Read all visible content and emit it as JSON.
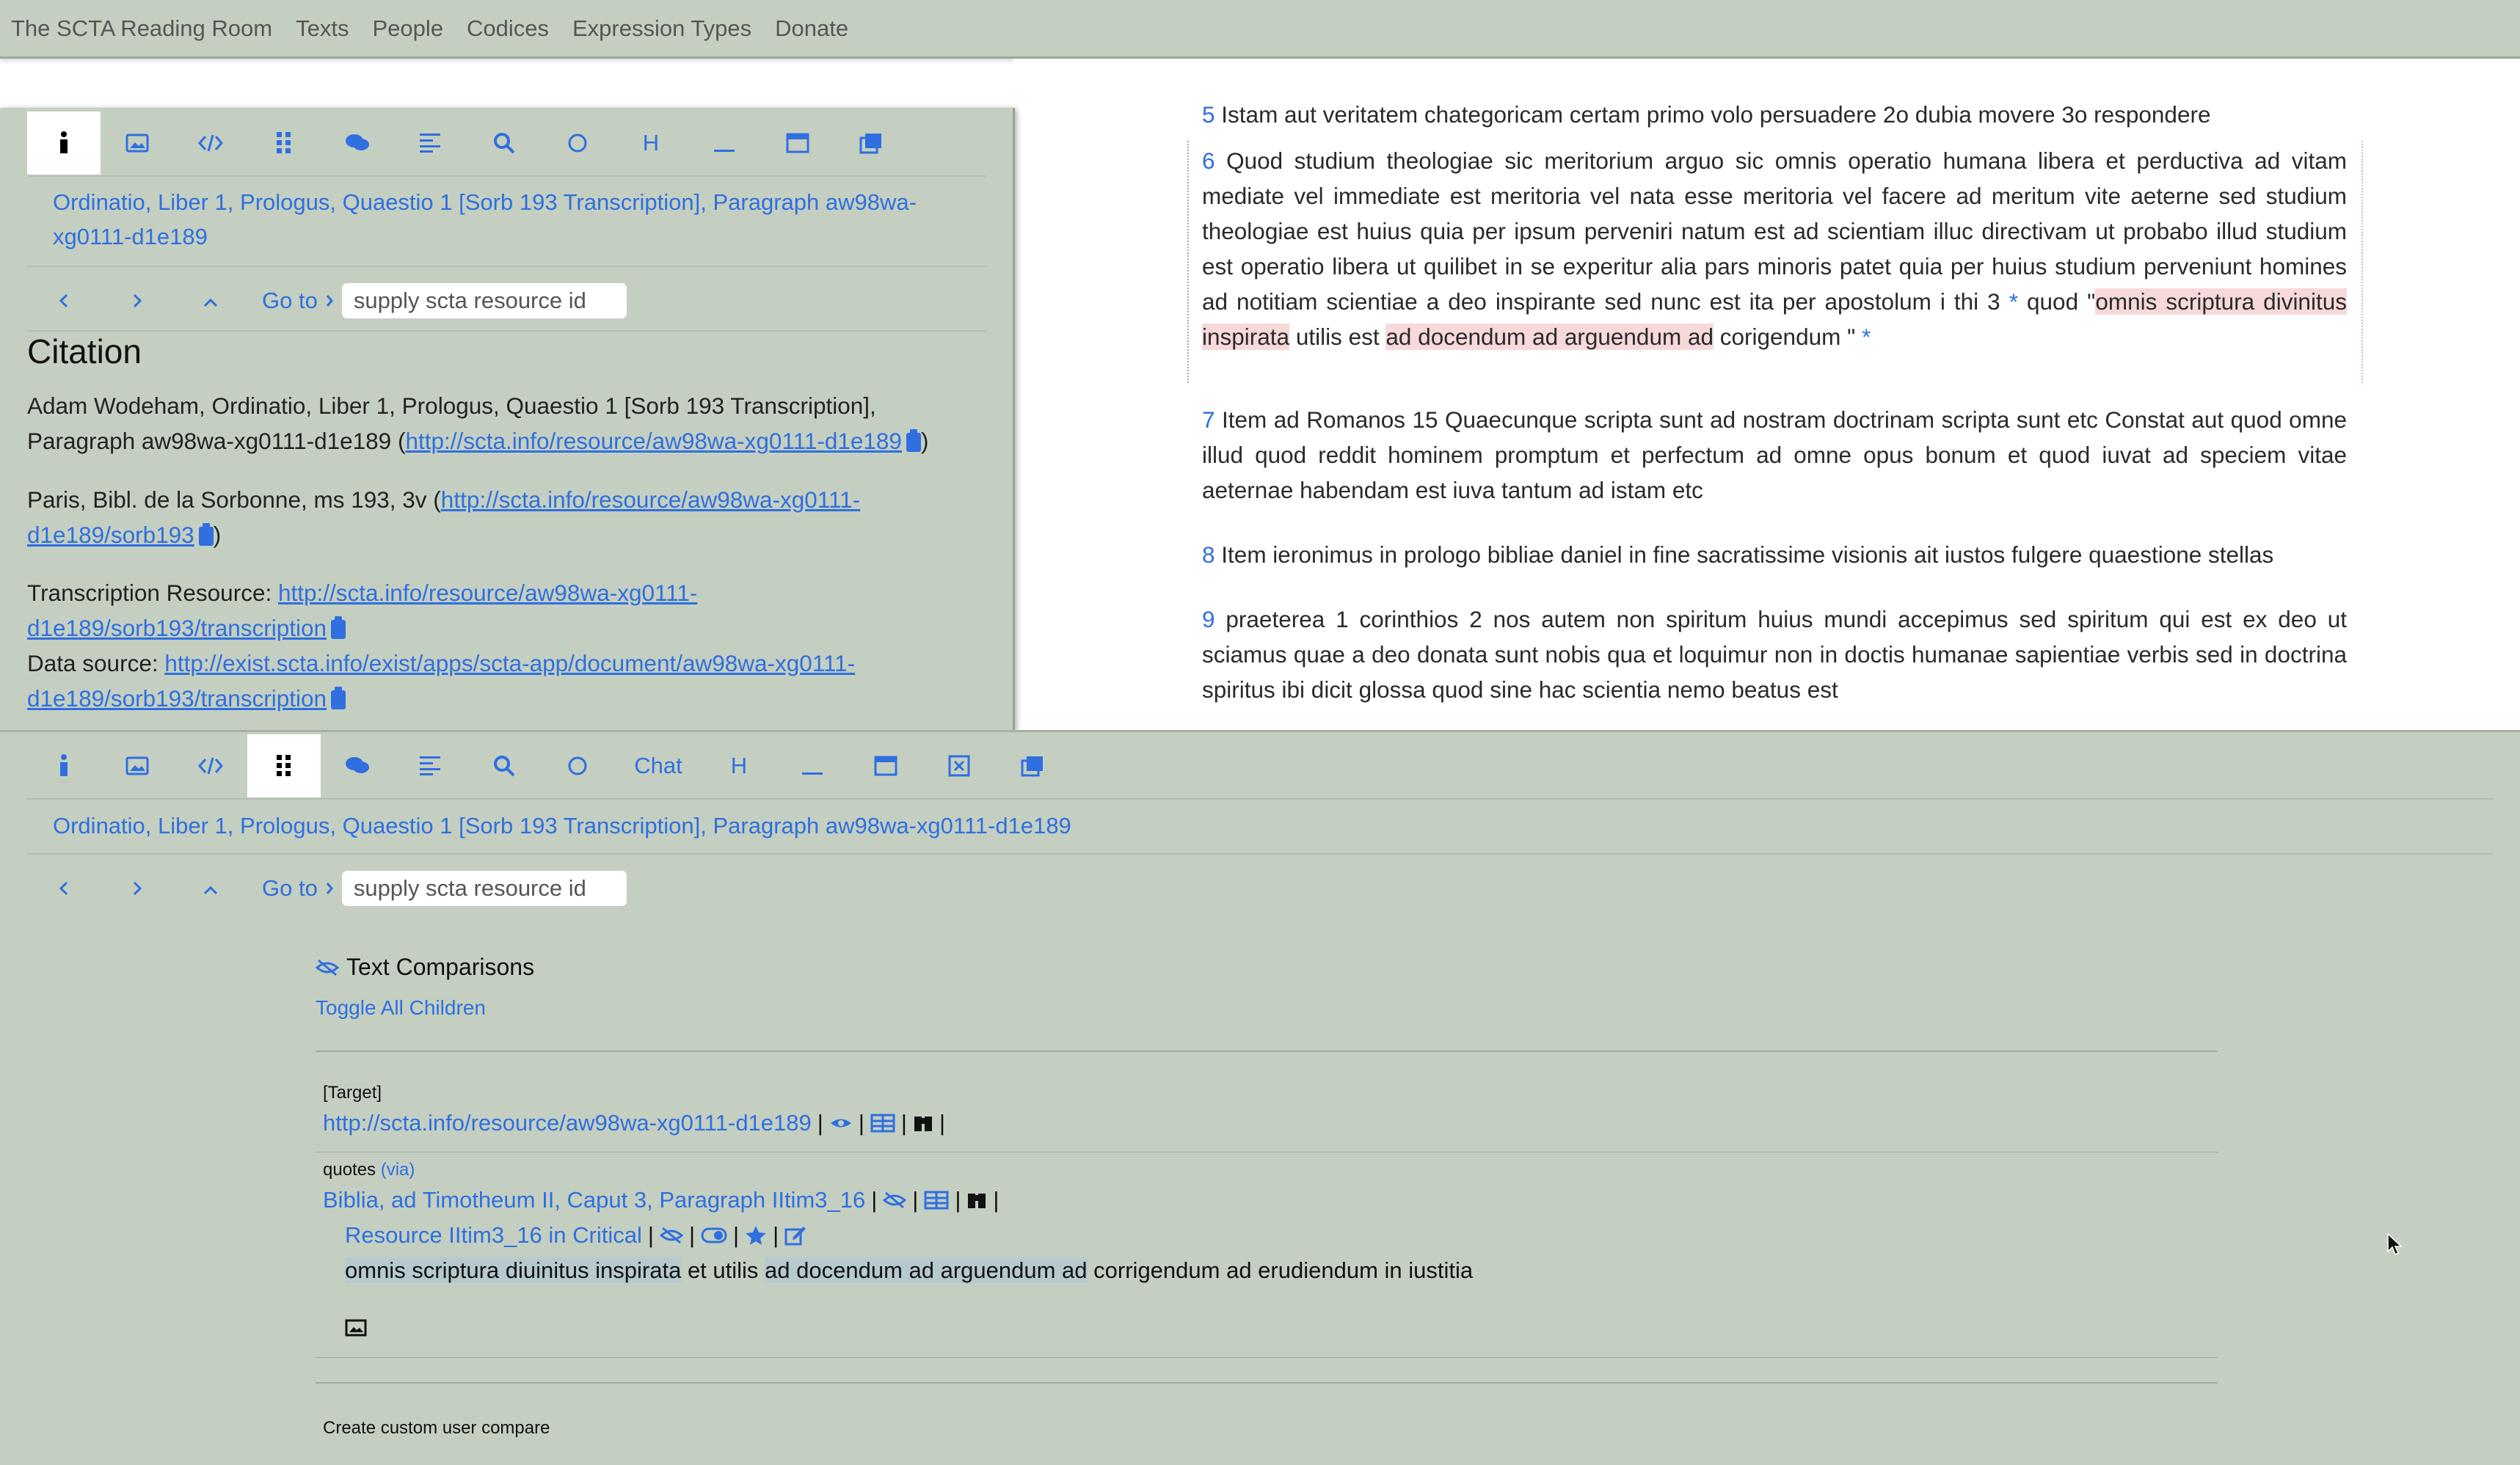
{
  "topnav": {
    "items": [
      "The SCTA Reading Room",
      "Texts",
      "People",
      "Codices",
      "Expression Types",
      "Donate"
    ]
  },
  "main_text": {
    "p5": {
      "num": "5",
      "text": "Istam aut veritatem chategoricam certam primo volo persuadere 2o dubia movere 3o respondere"
    },
    "p6": {
      "num": "6",
      "text_a": "Quod studium theologiae sic meritorium arguo sic omnis operatio humana libera et perductiva ad vitam mediate vel immediate est meritoria vel nata esse meritoria vel facere ad meritum vite aeterne sed studium theologiae est huius quia per ipsum perveniri natum est ad scientiam illuc directivam ut probabo illud studium est operatio libera ut quilibet in se experitur alia pars minoris patet quia per huius studium perveniunt homines ad notitiam scientiae a deo inspirante sed nunc est ita per apostolum i thi 3",
      "star": "*",
      "quod": "quod",
      "quote_open": "\"",
      "hl1": "omnis scriptura divinitus inspirata",
      "mid": "utilis est",
      "hl2": "ad docendum ad arguendum ad",
      "end": "corigendum \"",
      "star2": "*"
    },
    "p7": {
      "num": "7",
      "text": "Item ad Romanos 15 Quaecunque scripta sunt ad nostram doctrinam scripta sunt etc Constat aut quod omne illud quod reddit hominem promptum et perfectum ad omne opus bonum et quod iuvat ad speciem vitae aeternae habendam est iuva tantum ad istam etc"
    },
    "p8": {
      "num": "8",
      "text": "Item ieronimus in prologo bibliae daniel in fine sacratissime visionis ait iustos fulgere quaestione stellas"
    },
    "p9": {
      "num": "9",
      "text": "praeterea 1 corinthios 2 nos autem non spiritum huius mundi accepimus sed spiritum qui est ex deo ut sciamus quae a deo donata sunt nobis qua et loquimur non in doctis humanae sapientiae verbis sed in doctrina spiritus ibi dicit glossa quod sine hac scientia nemo beatus est"
    }
  },
  "left_panel": {
    "resource_title": "Ordinatio, Liber 1, Prologus, Quaestio 1 [Sorb 193 Transcription], Paragraph aw98wa-xg0111-d1e189",
    "goto_label": "Go to",
    "goto_placeholder": "supply scta resource id",
    "citation_heading": "Citation",
    "citation_text": "Adam Wodeham, Ordinatio, Liber 1, Prologus, Quaestio 1 [Sorb 193 Transcription], Paragraph aw98wa-xg0111-d1e189 (",
    "citation_link": "http://scta.info/resource/aw98wa-xg0111-d1e189",
    "citation_close": ")",
    "ms_text": "Paris, Bibl. de la Sorbonne, ms 193, 3v (",
    "ms_link": "http://scta.info/resource/aw98wa-xg0111-d1e189/sorb193",
    "ms_close": ")",
    "transcription_label": "Transcription Resource:",
    "transcription_link": "http://scta.info/resource/aw98wa-xg0111-d1e189/sorb193/transcription",
    "datasource_label": "Data source:",
    "datasource_link": "http://exist.scta.info/exist/apps/scta-app/document/aw98wa-xg0111-d1e189/sorb193/transcription"
  },
  "bottom_panel": {
    "chat_label": "Chat",
    "h_label": "H",
    "resource_title": "Ordinatio, Liber 1, Prologus, Quaestio 1 [Sorb 193 Transcription], Paragraph aw98wa-xg0111-d1e189",
    "goto_label": "Go to",
    "goto_placeholder": "supply scta resource id",
    "comparisons_title": "Text Comparisons",
    "toggle_label": "Toggle All Children",
    "target_label": "[Target]",
    "target_link": "http://scta.info/resource/aw98wa-xg0111-d1e189",
    "quotes_label": "quotes",
    "via_label": "(via)",
    "source_link": "Biblia, ad Timotheum II, Caput 3, Paragraph IItim3_16",
    "resource_link": "Resource IItim3_16 in Critical",
    "quote_hl1": "omnis scriptura diuinitus inspirata",
    "quote_mid": "et utilis",
    "quote_hl2": "ad docendum ad arguendum ad",
    "quote_end": "corrigendum ad erudiendum in iustitia",
    "create_label": "Create custom user compare"
  }
}
